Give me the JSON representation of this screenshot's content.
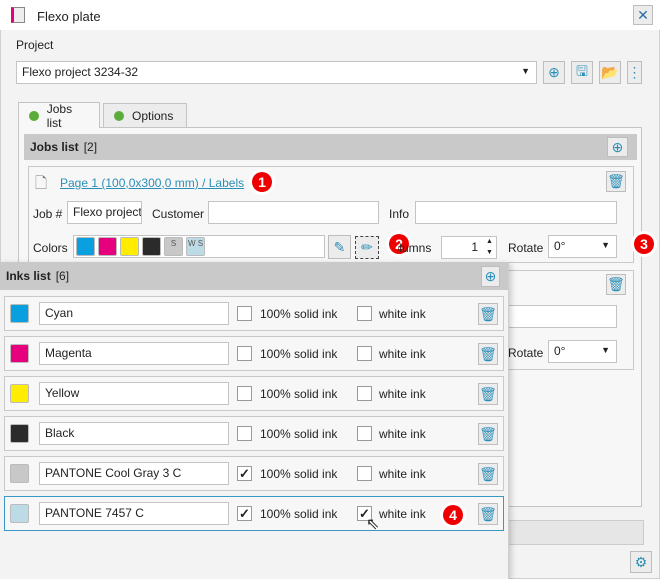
{
  "window": {
    "title": "Flexo plate"
  },
  "project": {
    "label": "Project",
    "value": "Flexo project 3234-32"
  },
  "tabs": [
    {
      "label": "Jobs list",
      "status_color": "#5aad3a"
    },
    {
      "label": "Options",
      "status_color": "#5aad3a"
    }
  ],
  "jobs_list": {
    "title": "Jobs list",
    "count": "[2]",
    "job1": {
      "link": "Page 1 (100,0x300,0 mm) / Labels",
      "job_label": "Job #",
      "job_value": "Flexo project",
      "customer_label": "Customer",
      "customer_value": "",
      "info_label": "Info",
      "info_value": "",
      "colors_label": "Colors",
      "columns_label": "Columns",
      "columns_value": "1",
      "rotate_label": "Rotate",
      "rotate_value": "0°",
      "swatches": [
        {
          "color": "#0aa0e0",
          "text": ""
        },
        {
          "color": "#e6007e",
          "text": ""
        },
        {
          "color": "#ffec00",
          "text": ""
        },
        {
          "color": "#2b2b2b",
          "text": ""
        },
        {
          "color": "#c8c8c8",
          "text": "S"
        },
        {
          "color": "#bcdbe6",
          "text": "W S"
        }
      ]
    },
    "job2": {
      "rotate_label": "Rotate",
      "rotate_value": "0°"
    }
  },
  "inks_list": {
    "title": "Inks list",
    "count": "[6]",
    "solid_label": "100% solid ink",
    "white_label": "white ink",
    "inks": [
      {
        "name": "Cyan",
        "color": "#0aa0e0",
        "solid": false,
        "white": false
      },
      {
        "name": "Magenta",
        "color": "#e6007e",
        "solid": false,
        "white": false
      },
      {
        "name": "Yellow",
        "color": "#ffec00",
        "solid": false,
        "white": false
      },
      {
        "name": "Black",
        "color": "#2b2b2b",
        "solid": false,
        "white": false
      },
      {
        "name": "PANTONE Cool Gray 3 C",
        "color": "#c8c8c8",
        "solid": true,
        "white": false
      },
      {
        "name": "PANTONE 7457 C",
        "color": "#bcdbe6",
        "solid": true,
        "white": true
      }
    ]
  },
  "badges": [
    "1",
    "2",
    "3",
    "4"
  ],
  "accent": "#2a8fb8"
}
